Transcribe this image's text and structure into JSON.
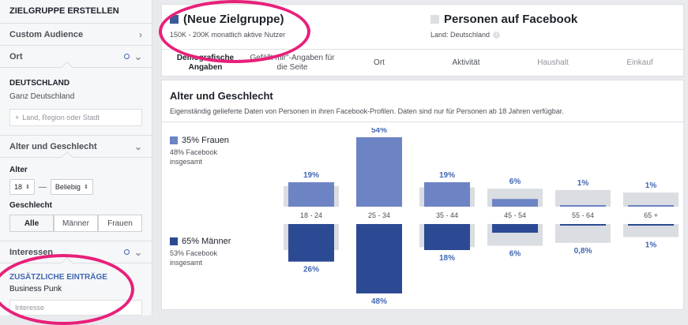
{
  "sidebar": {
    "title": "ZIELGRUPPE ERSTELLEN",
    "custom_audience": "Custom Audience",
    "ort": "Ort",
    "country": "DEUTSCHLAND",
    "country_scope": "Ganz Deutschland",
    "location_placeholder": "Land, Region oder Stadt",
    "age_gender": "Alter und Geschlecht",
    "age_label": "Alter",
    "age_min": "18",
    "age_sep": "—",
    "age_max": "Beliebig",
    "gender_label": "Geschlecht",
    "gender_options": [
      "Alle",
      "Männer",
      "Frauen"
    ],
    "interests": "Interessen",
    "extra_title": "ZUSÄTZLICHE EINTRÄGE",
    "extra_item": "Business Punk",
    "interest_placeholder": "Interesse"
  },
  "summary": {
    "title": "(Neue Zielgruppe)",
    "subtitle": "150K - 200K monatlich aktive Nutzer",
    "compare_title": "Personen auf Facebook",
    "compare_sub": "Land: Deutschland",
    "colors": {
      "audience": "#3b5998",
      "facebook": "#dddfe2",
      "accent": "#4267b2"
    }
  },
  "tabs": [
    {
      "label": "Demografische Angaben",
      "active": true
    },
    {
      "label": "Gefällt mir\"-Angaben für die Seite"
    },
    {
      "label": "Ort"
    },
    {
      "label": "Aktivität"
    },
    {
      "label": "Haushalt",
      "dim": true
    },
    {
      "label": "Einkauf",
      "dim": true
    }
  ],
  "chart_panel": {
    "title": "Alter und Geschlecht",
    "description": "Eigenständig gelieferte Daten von Personen in ihren Facebook-Profilen. Daten sind nur für Personen ab 18 Jahren verfügbar.",
    "women_label": "35% Frauen",
    "women_sub": "48% Facebook insgesamt",
    "men_label": "65% Männer",
    "men_sub": "53% Facebook insgesamt"
  },
  "chart_data": {
    "type": "bar",
    "categories": [
      "18 - 24",
      "25 - 34",
      "35 - 44",
      "45 - 54",
      "55 - 64",
      "65 +"
    ],
    "series": [
      {
        "name": "Frauen",
        "values": [
          19,
          54,
          19,
          6,
          1,
          1
        ],
        "labels": [
          "19%",
          "54%",
          "19%",
          "6%",
          "1%",
          "1%"
        ],
        "color": "#6d84c4"
      },
      {
        "name": "Männer",
        "values": [
          26,
          48,
          18,
          6,
          0.8,
          1
        ],
        "labels": [
          "26%",
          "48%",
          "18%",
          "6%",
          "0,8%",
          "1%"
        ],
        "color": "#2c4a94"
      }
    ],
    "facebook_reference": {
      "women": [
        16,
        0,
        15,
        14,
        13,
        11
      ],
      "men": [
        18,
        0,
        16,
        15,
        13,
        9
      ],
      "color": "#dadde1"
    }
  }
}
